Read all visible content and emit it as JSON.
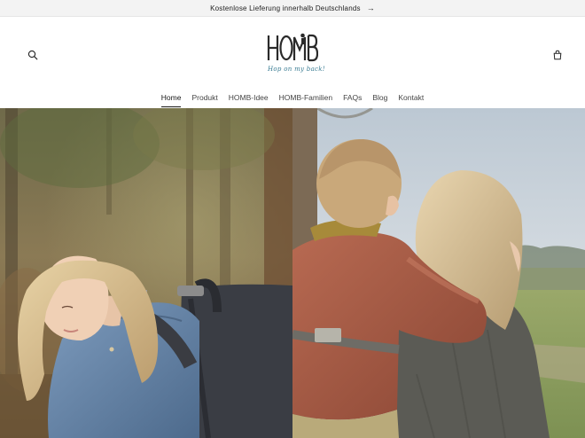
{
  "announcement": {
    "text": "Kostenlose Lieferung innerhalb Deutschlands",
    "arrow": "→"
  },
  "header": {
    "logo_text": "HOMB",
    "logo_tagline": "Hop on my back!",
    "search_icon": "search-icon",
    "cart_icon": "cart-icon"
  },
  "nav": {
    "items": [
      {
        "label": "Home",
        "active": true
      },
      {
        "label": "Produkt"
      },
      {
        "label": "HOMB-Idee"
      },
      {
        "label": "HOMB-Familien"
      },
      {
        "label": "FAQs"
      },
      {
        "label": "Blog"
      },
      {
        "label": "Kontakt"
      }
    ]
  },
  "colors": {
    "announcement_bg": "#f3f3f3",
    "tagline": "#3a7c93",
    "text": "#1f1f1f"
  }
}
